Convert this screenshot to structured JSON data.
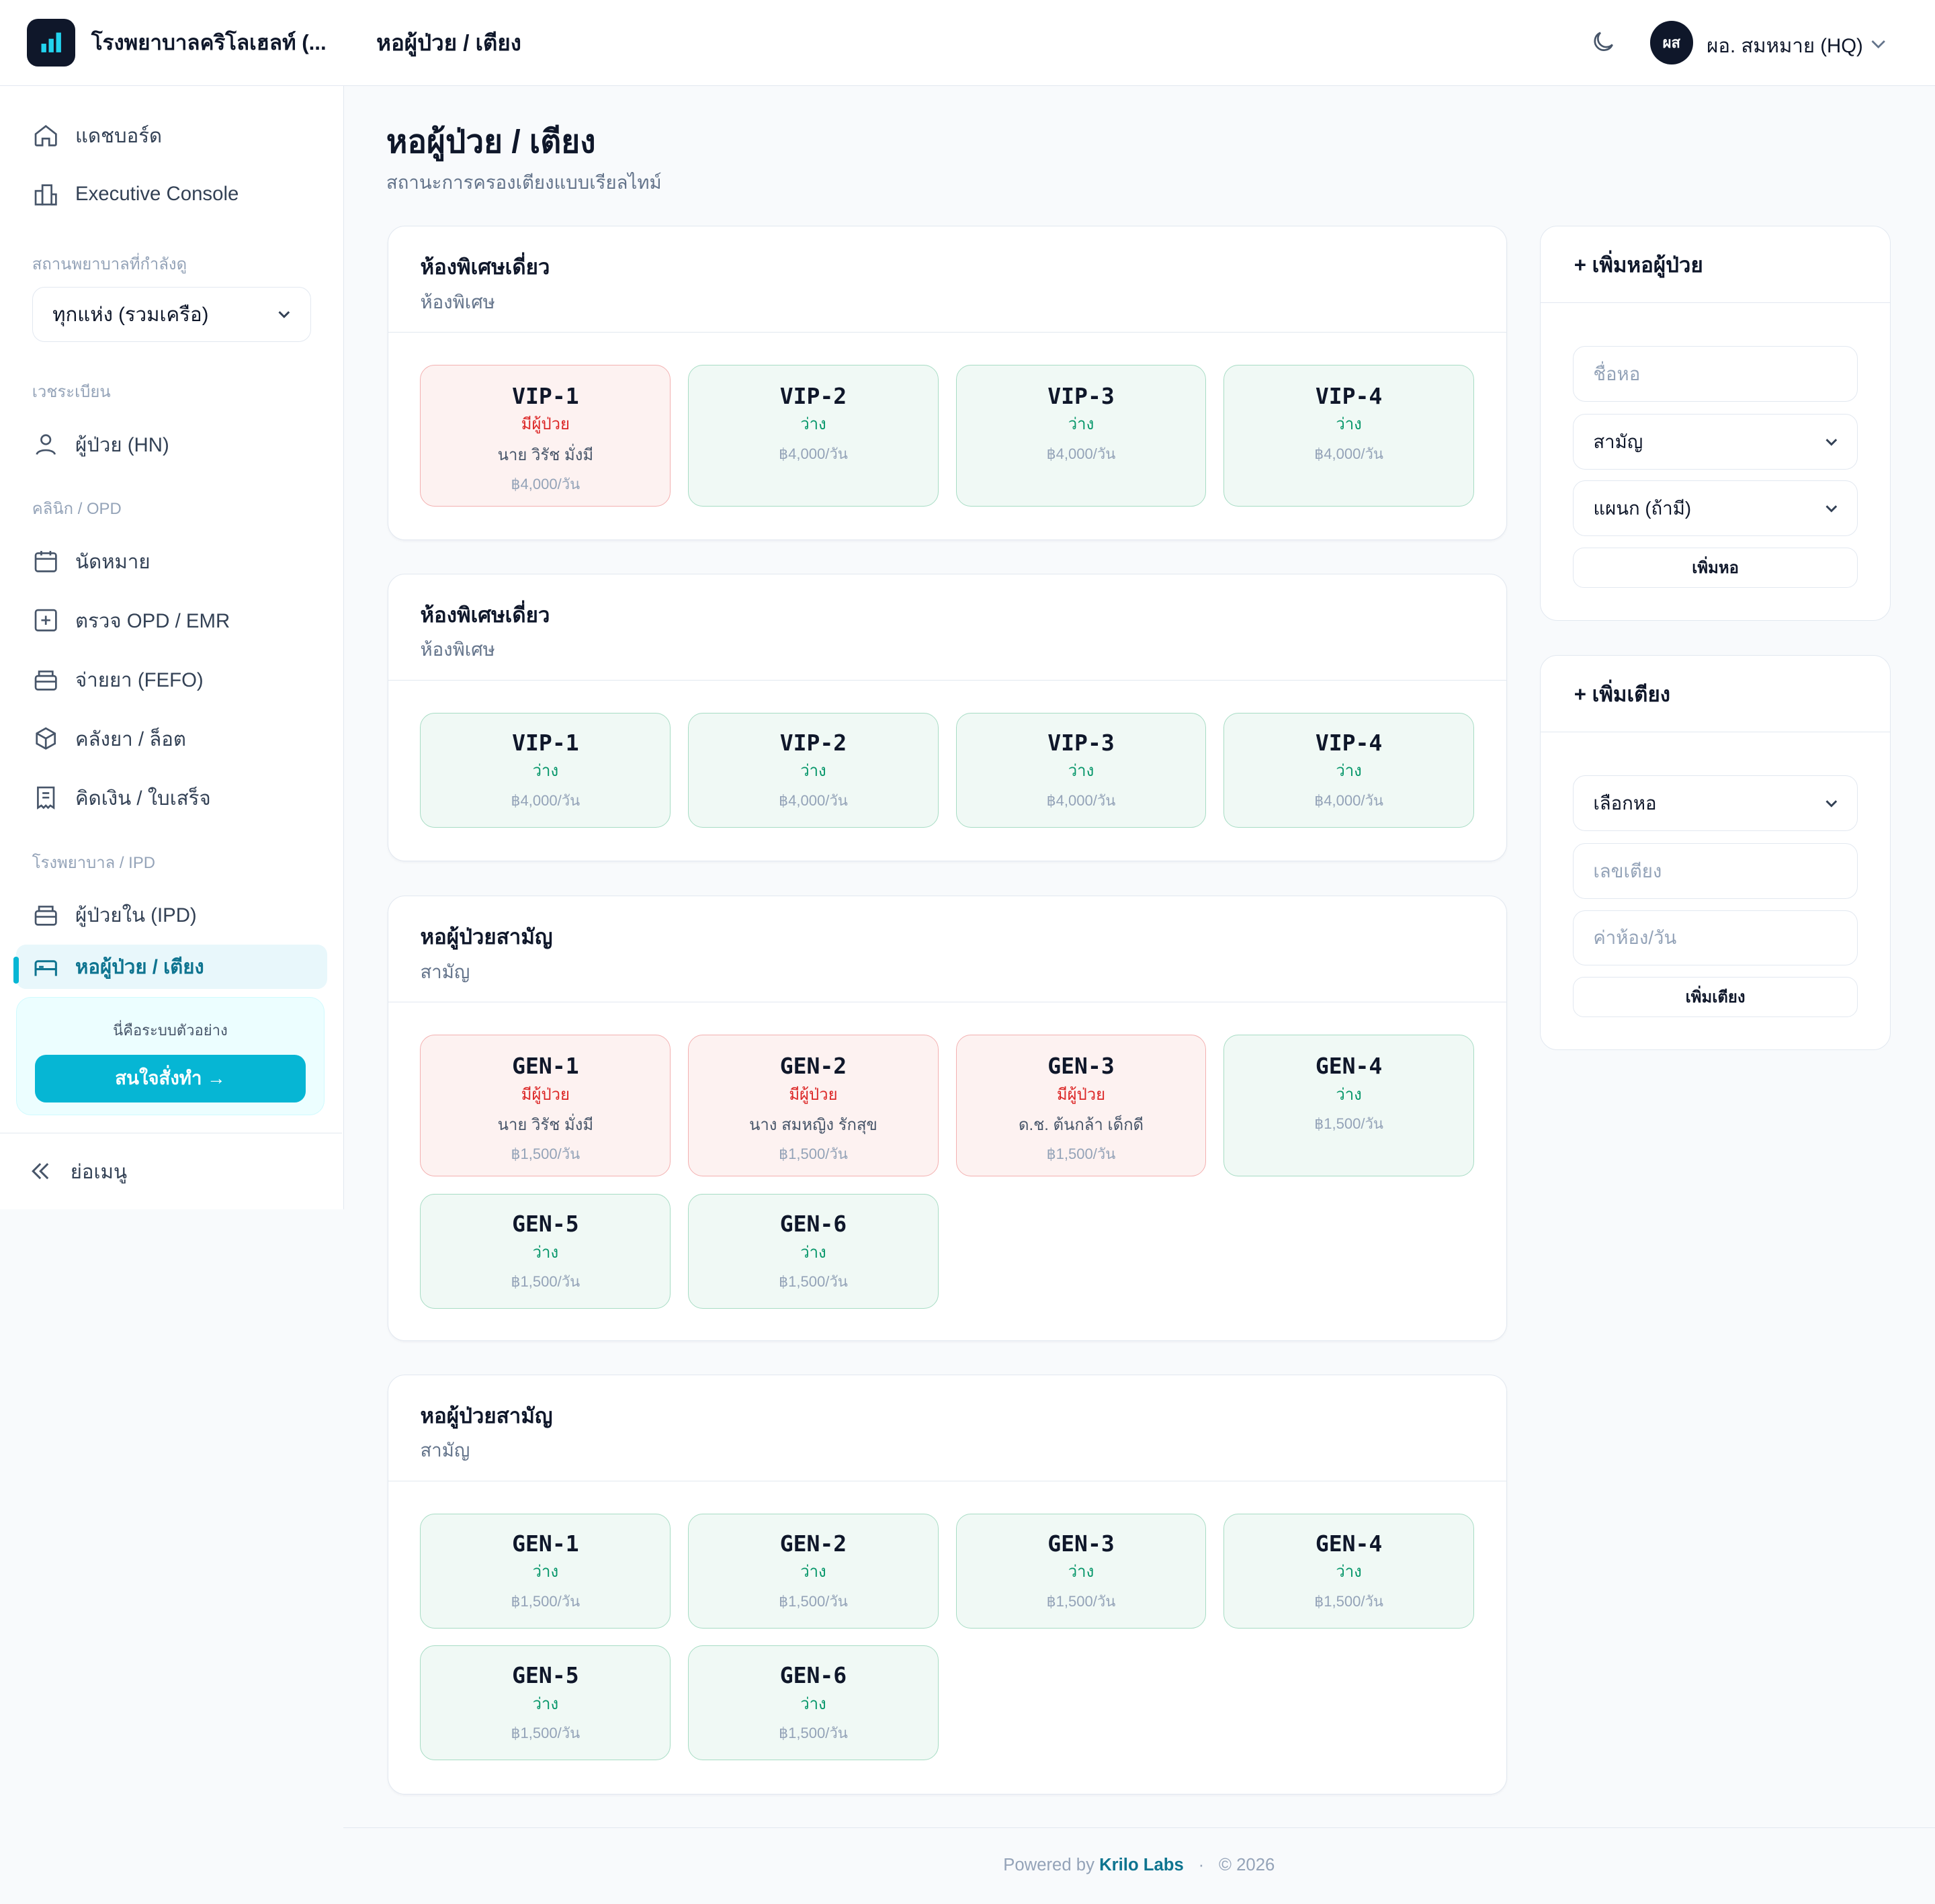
{
  "sidebar": {
    "hospital_name": "โรงพยาบาลคริโลเฮลท์ (...",
    "dashboard": "แดชบอร์ด",
    "executive": "Executive Console",
    "branch_label": "สถานพยาบาลที่กำลังดู",
    "branch_value": "ทุกแห่ง (รวมเครือ)",
    "registry_label": "เวชระเบียน",
    "patients": "ผู้ป่วย (HN)",
    "opd_label": "คลินิก / OPD",
    "appointments": "นัดหมาย",
    "opd_emr": "ตรวจ OPD / EMR",
    "dispense": "จ่ายยา (FEFO)",
    "inventory": "คลังยา / ล็อต",
    "billing": "คิดเงิน / ใบเสร็จ",
    "ipd_label": "โรงพยาบาล / IPD",
    "inpatients": "ผู้ป่วยใน (IPD)",
    "wards": "หอผู้ป่วย / เตียง",
    "demo_text": "นี่คือระบบตัวอย่าง",
    "demo_button": "สนใจสั่งทำ →",
    "collapse": "ย่อเมนู"
  },
  "header": {
    "title": "หอผู้ป่วย / เตียง",
    "avatar": "ผส",
    "user": "ผอ. สมหมาย (HQ)"
  },
  "page": {
    "title": "หอผู้ป่วย / เตียง",
    "subtitle": "สถานะการครองเตียงแบบเรียลไทม์"
  },
  "wards": [
    {
      "name": "ห้องพิเศษเดี่ยว",
      "type": "ห้องพิเศษ",
      "beds": [
        {
          "code": "VIP-1",
          "status": "มีผู้ป่วย",
          "patient": "นาย วิรัช มั่งมี",
          "price": "฿4,000/วัน",
          "occupied": true
        },
        {
          "code": "VIP-2",
          "status": "ว่าง",
          "price": "฿4,000/วัน",
          "occupied": false
        },
        {
          "code": "VIP-3",
          "status": "ว่าง",
          "price": "฿4,000/วัน",
          "occupied": false
        },
        {
          "code": "VIP-4",
          "status": "ว่าง",
          "price": "฿4,000/วัน",
          "occupied": false
        }
      ]
    },
    {
      "name": "ห้องพิเศษเดี่ยว",
      "type": "ห้องพิเศษ",
      "beds": [
        {
          "code": "VIP-1",
          "status": "ว่าง",
          "price": "฿4,000/วัน",
          "occupied": false
        },
        {
          "code": "VIP-2",
          "status": "ว่าง",
          "price": "฿4,000/วัน",
          "occupied": false
        },
        {
          "code": "VIP-3",
          "status": "ว่าง",
          "price": "฿4,000/วัน",
          "occupied": false
        },
        {
          "code": "VIP-4",
          "status": "ว่าง",
          "price": "฿4,000/วัน",
          "occupied": false
        }
      ]
    },
    {
      "name": "หอผู้ป่วยสามัญ",
      "type": "สามัญ",
      "beds": [
        {
          "code": "GEN-1",
          "status": "มีผู้ป่วย",
          "patient": "นาย วิรัช มั่งมี",
          "price": "฿1,500/วัน",
          "occupied": true
        },
        {
          "code": "GEN-2",
          "status": "มีผู้ป่วย",
          "patient": "นาง สมหญิง รักสุข",
          "price": "฿1,500/วัน",
          "occupied": true
        },
        {
          "code": "GEN-3",
          "status": "มีผู้ป่วย",
          "patient": "ด.ช. ต้นกล้า เด็กดี",
          "price": "฿1,500/วัน",
          "occupied": true
        },
        {
          "code": "GEN-4",
          "status": "ว่าง",
          "price": "฿1,500/วัน",
          "occupied": false
        },
        {
          "code": "GEN-5",
          "status": "ว่าง",
          "price": "฿1,500/วัน",
          "occupied": false
        },
        {
          "code": "GEN-6",
          "status": "ว่าง",
          "price": "฿1,500/วัน",
          "occupied": false
        }
      ]
    },
    {
      "name": "หอผู้ป่วยสามัญ",
      "type": "สามัญ",
      "beds": [
        {
          "code": "GEN-1",
          "status": "ว่าง",
          "price": "฿1,500/วัน",
          "occupied": false
        },
        {
          "code": "GEN-2",
          "status": "ว่าง",
          "price": "฿1,500/วัน",
          "occupied": false
        },
        {
          "code": "GEN-3",
          "status": "ว่าง",
          "price": "฿1,500/วัน",
          "occupied": false
        },
        {
          "code": "GEN-4",
          "status": "ว่าง",
          "price": "฿1,500/วัน",
          "occupied": false
        },
        {
          "code": "GEN-5",
          "status": "ว่าง",
          "price": "฿1,500/วัน",
          "occupied": false
        },
        {
          "code": "GEN-6",
          "status": "ว่าง",
          "price": "฿1,500/วัน",
          "occupied": false
        }
      ]
    }
  ],
  "add_ward": {
    "title": "+ เพิ่มหอผู้ป่วย",
    "name_placeholder": "ชื่อหอ",
    "type_value": "สามัญ",
    "dept_value": "แผนก (ถ้ามี)",
    "button": "เพิ่มหอ"
  },
  "add_bed": {
    "title": "+ เพิ่มเตียง",
    "ward_value": "เลือกหอ",
    "bed_placeholder": "เลขเตียง",
    "rate_placeholder": "ค่าห้อง/วัน",
    "button": "เพิ่มเตียง"
  },
  "footer": {
    "powered": "Powered by",
    "company": "Krilo Labs",
    "sep": "·",
    "year": "© 2026"
  },
  "colors": {
    "accent": "#06b6d4",
    "occupied_border": "#f3b0b0",
    "free_border": "#a7dcc4"
  }
}
